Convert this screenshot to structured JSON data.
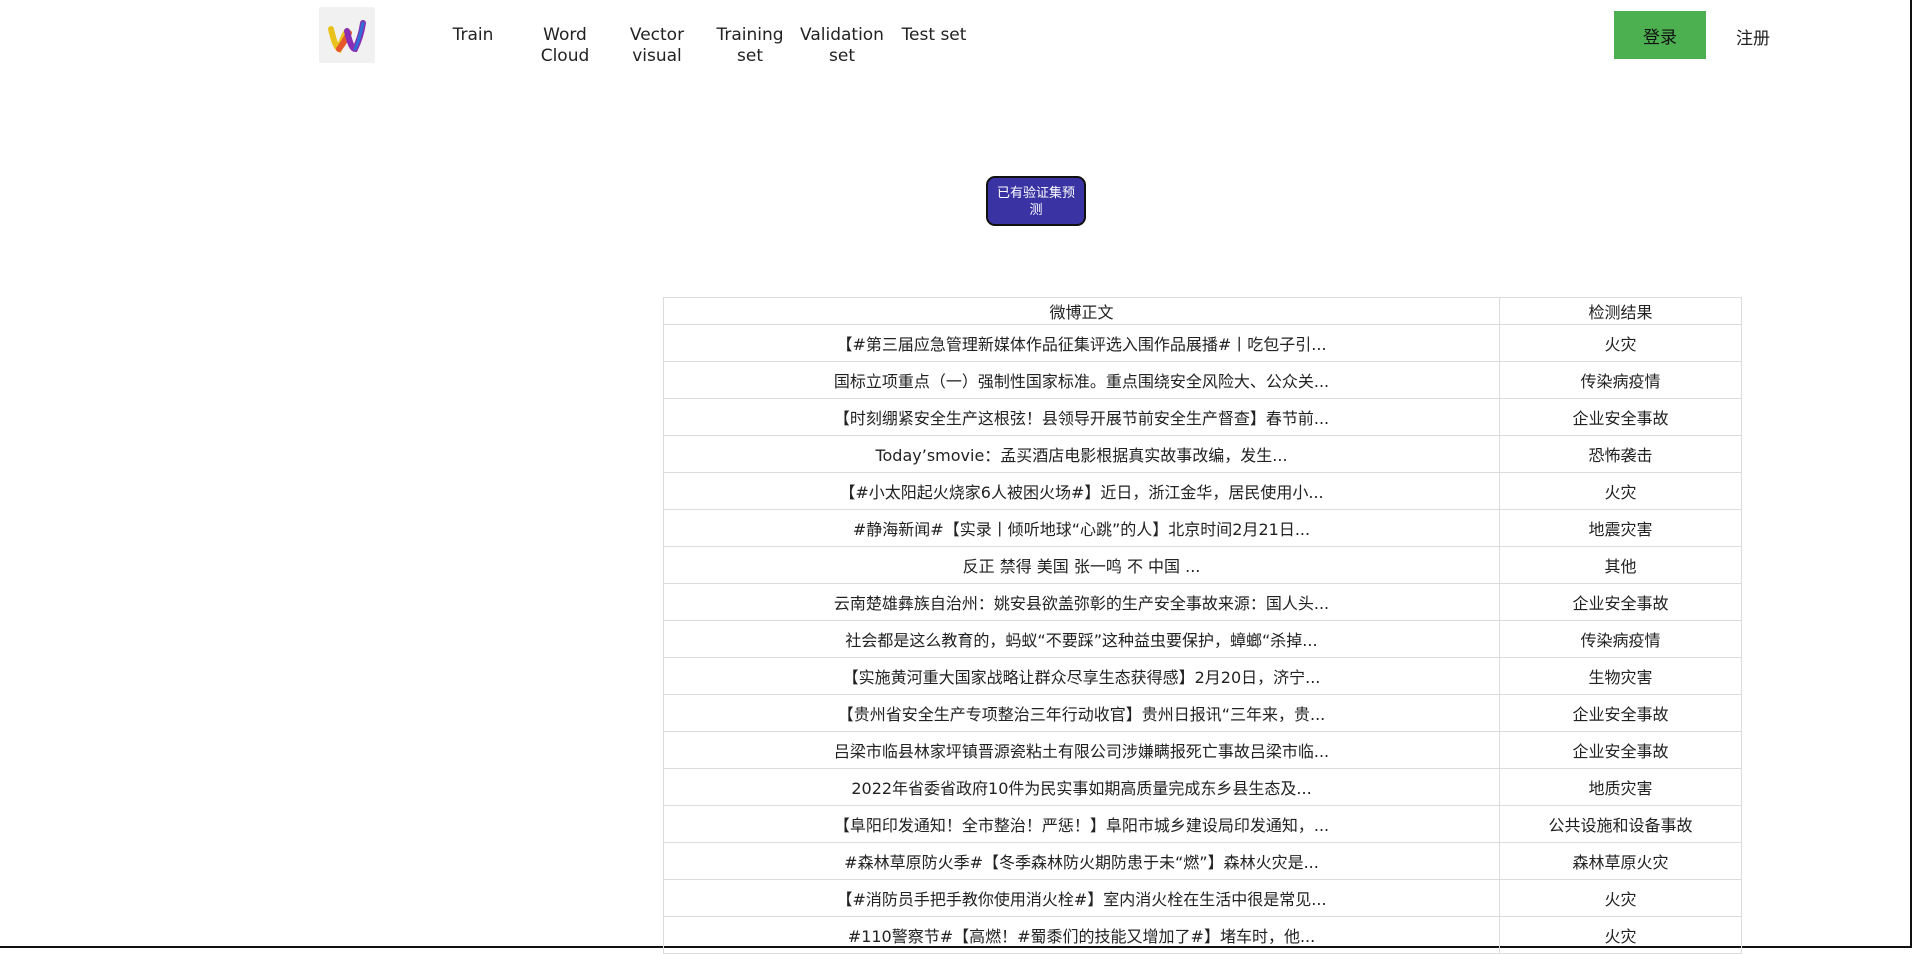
{
  "nav": {
    "items": [
      {
        "label": "Train"
      },
      {
        "label": "Word\nCloud"
      },
      {
        "label": "Vector\nvisual"
      },
      {
        "label": "Training\nset"
      },
      {
        "label": "Validation\nset"
      },
      {
        "label": "Test set"
      }
    ]
  },
  "auth": {
    "login_label": "登录",
    "register_label": "注册",
    "login_color": "#4caf50"
  },
  "main": {
    "predict_button_label": "已有验证集预测",
    "predict_button_color": "#3a33a3"
  },
  "table": {
    "headers": [
      "微博正文",
      "检测结果"
    ],
    "rows": [
      {
        "text": "【#第三届应急管理新媒体作品征集评选入围作品展播#丨吃包子引...",
        "result": "火灾"
      },
      {
        "text": "国标立项重点（一）强制性国家标准。重点围绕安全风险大、公众关...",
        "result": "传染病疫情"
      },
      {
        "text": "【时刻绷紧安全生产这根弦！县领导开展节前安全生产督查】春节前...",
        "result": "企业安全事故"
      },
      {
        "text": "Today’smovie：孟买酒店电影根据真实故事改编，发生...",
        "result": "恐怖袭击"
      },
      {
        "text": "【#小太阳起火烧家6人被困火场#】近日，浙江金华，居民使用小...",
        "result": "火灾"
      },
      {
        "text": "#静海新闻#【实录丨倾听地球“心跳”的人】北京时间2月21日...",
        "result": "地震灾害"
      },
      {
        "text": "反正 禁得 美国 张一鸣 不 中国 ...",
        "result": "其他"
      },
      {
        "text": "云南楚雄彝族自治州：姚安县欲盖弥彰的生产安全事故来源：国人头...",
        "result": "企业安全事故"
      },
      {
        "text": "社会都是这么教育的，蚂蚁“不要踩”这种益虫要保护，蟑螂“杀掉...",
        "result": "传染病疫情"
      },
      {
        "text": "【实施黄河重大国家战略让群众尽享生态获得感】2月20日，济宁...",
        "result": "生物灾害"
      },
      {
        "text": "【贵州省安全生产专项整治三年行动收官】贵州日报讯“三年来，贵...",
        "result": "企业安全事故"
      },
      {
        "text": "吕梁市临县林家坪镇晋源瓷粘土有限公司涉嫌瞒报死亡事故吕梁市临...",
        "result": "企业安全事故"
      },
      {
        "text": "2022年省委省政府10件为民实事如期高质量完成东乡县生态及...",
        "result": "地质灾害"
      },
      {
        "text": "【阜阳印发通知！全市整治！严惩！】阜阳市城乡建设局印发通知，...",
        "result": "公共设施和设备事故"
      },
      {
        "text": "#森林草原防火季#【冬季森林防火期防患于未“燃”】森林火灾是...",
        "result": "森林草原火灾"
      },
      {
        "text": "【#消防员手把手教你使用消火栓#】室内消火栓在生活中很是常见...",
        "result": "火灾"
      },
      {
        "text": "#110警察节#【高燃！#蜀黍们的技能又增加了#】堵车时，他...",
        "result": "火灾"
      }
    ]
  }
}
